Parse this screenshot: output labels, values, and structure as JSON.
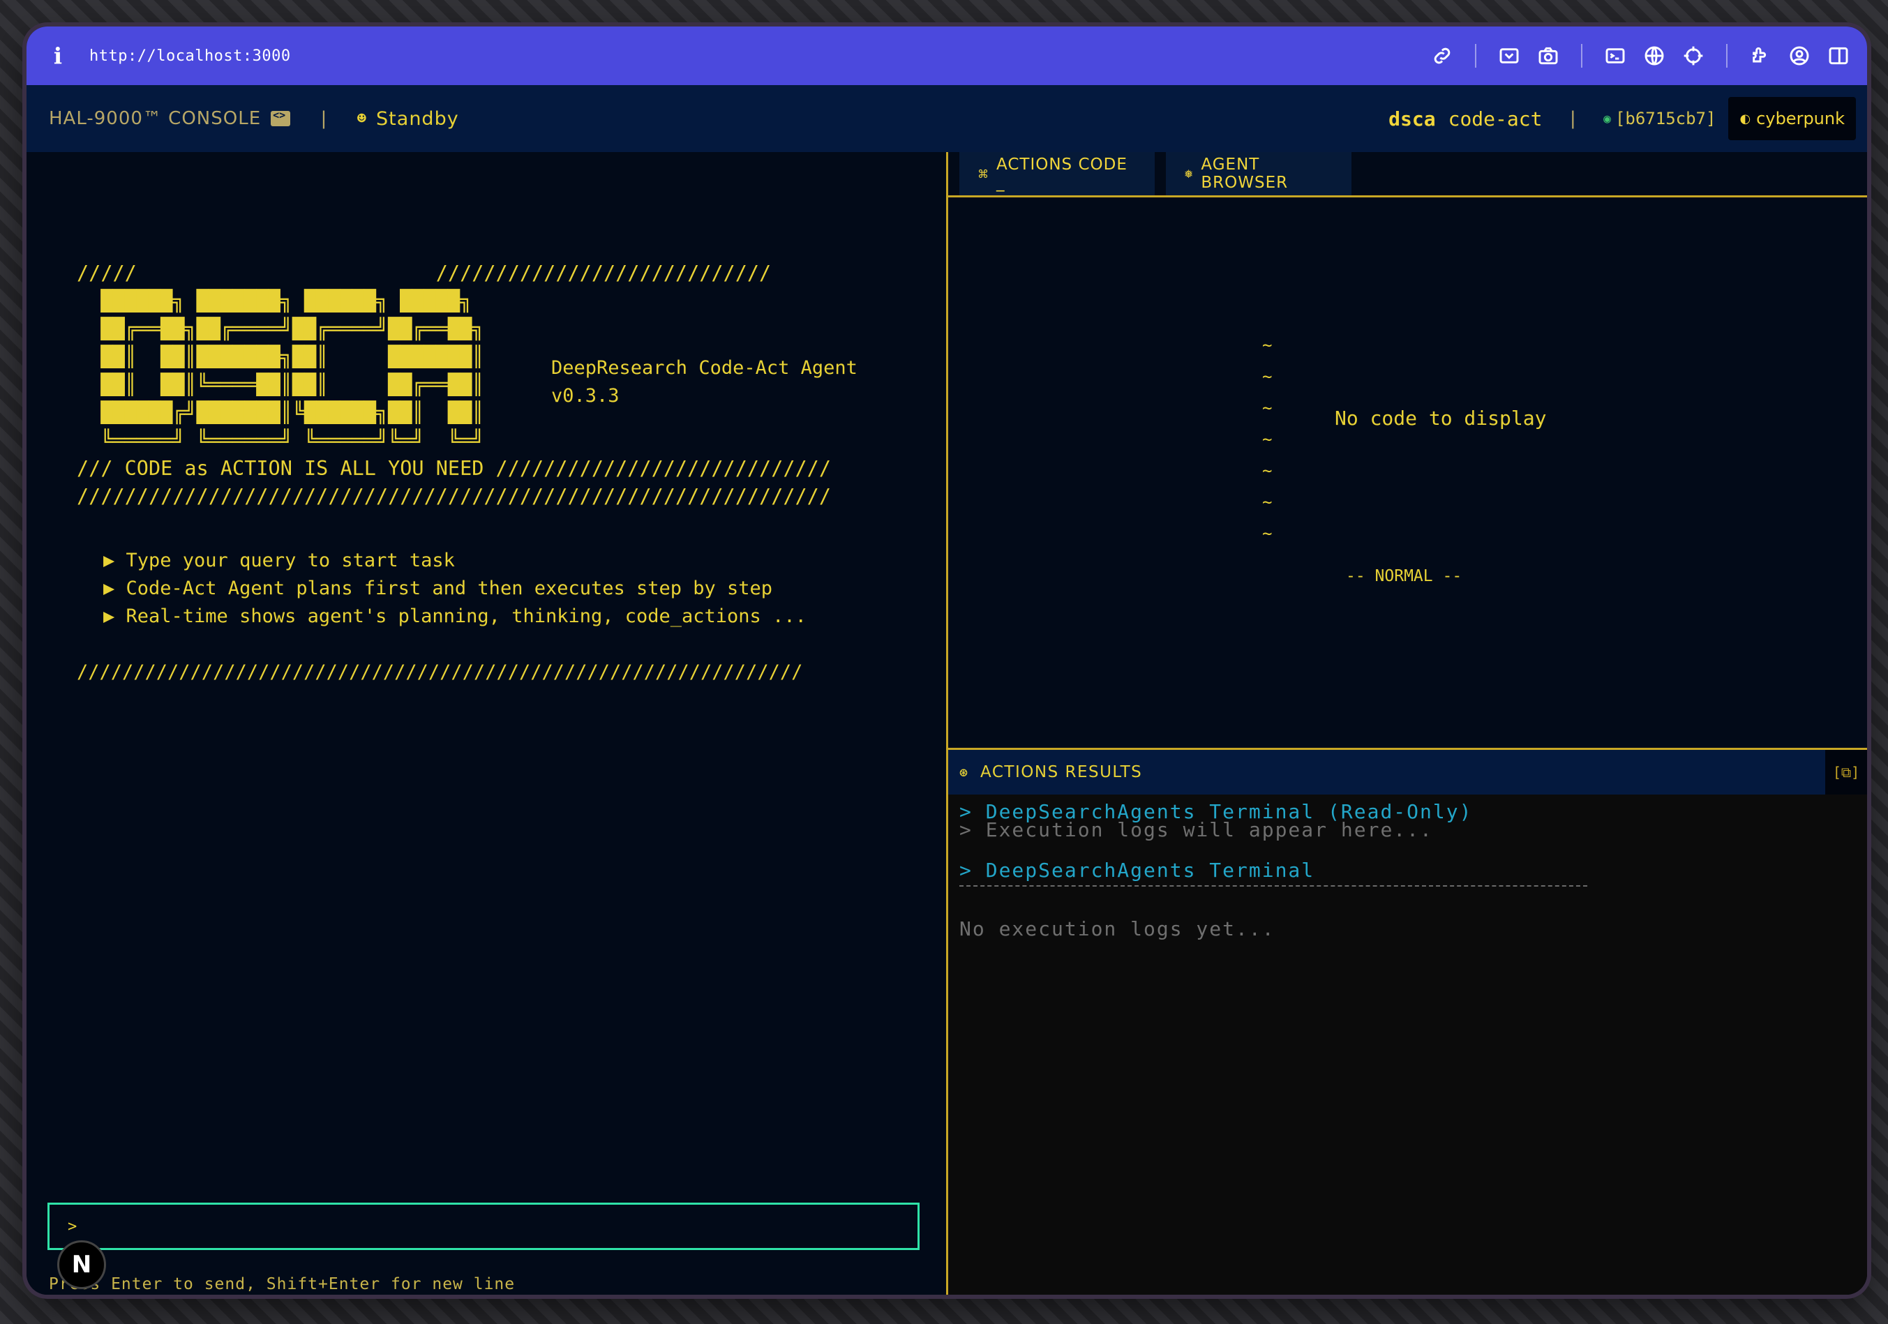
{
  "browser": {
    "url": "http://localhost:3000",
    "icons": [
      "info-icon",
      "link-icon",
      "screen-capture-icon",
      "camera-icon",
      "terminal-icon",
      "globe-icon",
      "crosshair-icon",
      "extensions-icon",
      "profile-icon",
      "sidebar-icon"
    ]
  },
  "header": {
    "brand": "HAL-9000™ CONSOLE",
    "separator": "|",
    "status_dot": "☻",
    "status": "Standby",
    "app_name": "dsca",
    "app_mode": "code-act",
    "commit_dot": "◉",
    "commit": "[b6715cb7]",
    "theme_icon": "◐",
    "theme": "cyberpunk"
  },
  "left": {
    "ascii_art": "/////                         ////////////////////////////\n  ██████╗ ███████╗ ██████╗ █████╗\n  ██╔══██╗██╔════╝██╔════╝██╔══██╗\n  ██║  ██║███████╗██║     ███████║\n  ██║  ██║╚════██║██║     ██╔══██║\n  ██████╔╝███████║╚██████╗██║  ██║\n  ╚═════╝ ╚══════╝ ╚═════╝╚═╝  ╚═╝\n/// CODE as ACTION IS ALL YOU NEED ////////////////////////////\n///////////////////////////////////////////////////////////////",
    "agent_name": "DeepResearch Code-Act Agent",
    "version": "v0.3.3",
    "bullets": [
      "▶ Type your query to start task",
      "▶ Code-Act Agent plans first and then executes step by step",
      "▶ Real-time shows agent's planning, thinking, code_actions ..."
    ],
    "bottom_rule": "////////////////////////////////////////////////////////////////",
    "input_prompt": ">",
    "input_value": "",
    "hint": "Press Enter to send, Shift+Enter for new line",
    "badge": "N"
  },
  "right": {
    "tabs": [
      {
        "icon": "⌘",
        "label": "ACTIONS CODE _"
      },
      {
        "icon": "❅",
        "label": "AGENT BROWSER"
      }
    ],
    "tildes": "~\n~\n~\n~\n~\n~\n~",
    "empty_code": "No code to display",
    "mode": "-- NORMAL --",
    "results_icon": "⊛",
    "results_title": "ACTIONS RESULTS",
    "results_button": "[⧉]",
    "terminal": {
      "line1": "> DeepSearchAgents Terminal (Read-Only)",
      "line2": "> Execution logs will appear here...",
      "line3": "> DeepSearchAgents Terminal",
      "empty": "No execution logs yet..."
    }
  }
}
